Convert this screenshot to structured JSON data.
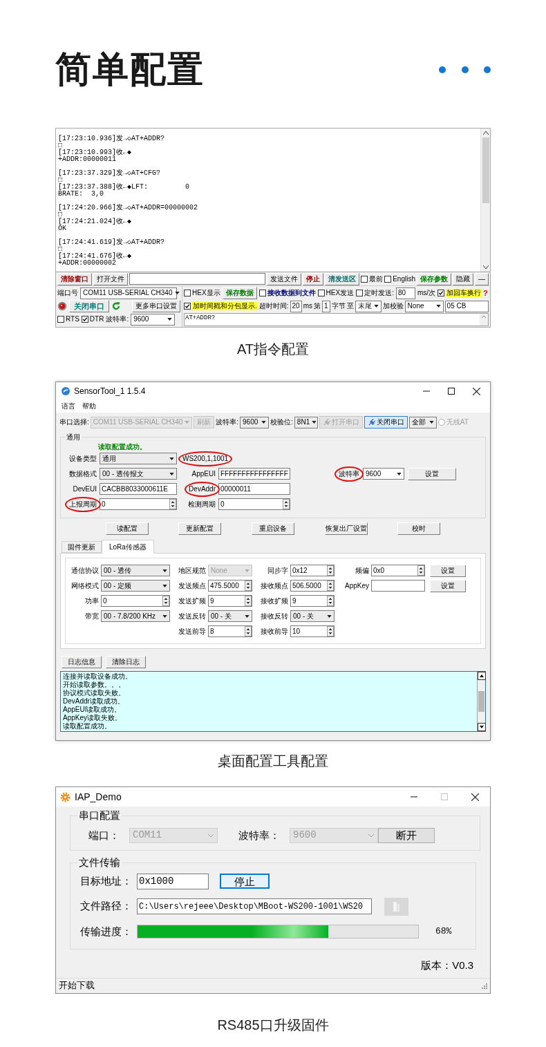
{
  "heading": {
    "title": "简单配置"
  },
  "at_tool": {
    "log": [
      {
        "lines": [
          "[17:23:10.936]发→◇AT+ADDR?",
          "□",
          "[17:23:10.993]收←◆",
          "+ADDR:00000011"
        ]
      },
      {
        "lines": [
          "[17:23:37.329]发→◇AT+CFG?",
          "□",
          "[17:23:37.388]收←◆LFT:         0",
          "BRATE:  3,0"
        ]
      },
      {
        "lines": [
          "[17:24:20.966]发→◇AT+ADDR=00000002",
          "□",
          "[17:24:21.024]收←◆",
          "OK"
        ]
      },
      {
        "lines": [
          "[17:24:41.619]发→◇AT+ADDR?",
          "□",
          "[17:24:41.676]收←◆",
          "+ADDR:00000002"
        ]
      }
    ],
    "toolbar": [
      {
        "kind": "button",
        "label": "清除窗口",
        "color": "#8b0000"
      },
      {
        "kind": "button",
        "label": "打开文件"
      },
      {
        "kind": "field"
      },
      {
        "kind": "button",
        "label": "发送文件"
      },
      {
        "kind": "button",
        "label": "停止",
        "color": "#a00000"
      },
      {
        "kind": "button",
        "label": "清发送区",
        "color": "#006b6b"
      },
      {
        "kind": "checkbox",
        "label": "最前",
        "checked": false
      },
      {
        "kind": "checkbox",
        "label": "English",
        "checked": false
      },
      {
        "kind": "button",
        "label": "保存参数",
        "color": "#008000"
      },
      {
        "kind": "button",
        "label": "隐藏"
      },
      {
        "kind": "button",
        "label": "—"
      }
    ],
    "port_panel": {
      "rows": [
        [
          {
            "kind": "label",
            "text": "端口号"
          },
          {
            "kind": "combo",
            "value": "COM11 USB-SERIAL CH340"
          }
        ],
        [
          {
            "kind": "button",
            "label": "关闭串口",
            "color": "#007a7a"
          },
          {
            "kind": "button",
            "label": "更多串口设置"
          }
        ],
        [
          {
            "kind": "checkbox",
            "label": "RTS",
            "checked": false
          },
          {
            "kind": "checkbox",
            "label": "DTR",
            "checked": true
          },
          {
            "kind": "label",
            "text": "波特率:"
          },
          {
            "kind": "combo",
            "value": "9600"
          }
        ]
      ]
    },
    "options_row_1": [
      {
        "kind": "checkbox",
        "label": "HEX显示",
        "checked": false
      },
      {
        "kind": "button",
        "label": "保存数据",
        "color": "#008000"
      },
      {
        "kind": "checkbox",
        "label": "接收数据到文件",
        "checked": false,
        "color": "#000080"
      },
      {
        "kind": "checkbox",
        "label": "HEX发送",
        "checked": false
      },
      {
        "kind": "checkbox",
        "label": "定时发送:",
        "checked": false
      },
      {
        "kind": "field",
        "value": "80"
      },
      {
        "kind": "label",
        "text": "ms/次"
      },
      {
        "kind": "checkbox",
        "label": "加回车换行",
        "checked": true,
        "highlighted": true
      }
    ],
    "help_mark": "?",
    "options_row_2": [
      {
        "kind": "checkbox",
        "label": "加时间戳和分包显示.",
        "checked": true,
        "highlighted": true
      },
      {
        "kind": "label",
        "text": "超时时间:"
      },
      {
        "kind": "field",
        "value": "20"
      },
      {
        "kind": "label",
        "text": "ms"
      },
      {
        "kind": "label",
        "text": "第"
      },
      {
        "kind": "field",
        "value": "1"
      },
      {
        "kind": "label",
        "text": "字节"
      },
      {
        "kind": "label",
        "text": "至"
      },
      {
        "kind": "combo",
        "value": "末尾"
      },
      {
        "kind": "label",
        "text": "加校验"
      },
      {
        "kind": "combo",
        "value": "None"
      },
      {
        "kind": "field",
        "value": "05 CB"
      }
    ],
    "send_text": "AT+ADDR?",
    "caption": "AT指令配置"
  },
  "sensor_tool": {
    "title": "SensorTool_1 1.5.4",
    "menu": [
      "语言",
      "帮助"
    ],
    "toolbar": [
      {
        "kind": "label",
        "text": "串口选择:"
      },
      {
        "kind": "combo",
        "value": "COM11 USB-SERIAL CH340",
        "disabled": true
      },
      {
        "kind": "button",
        "label": "刷新",
        "disabled": true
      },
      {
        "kind": "label",
        "text": "波特率:"
      },
      {
        "kind": "combo",
        "value": "9600"
      },
      {
        "kind": "label",
        "text": "校验位:"
      },
      {
        "kind": "combo",
        "value": "8N1"
      },
      {
        "kind": "button",
        "label": "打开串口",
        "disabled": true
      },
      {
        "kind": "button",
        "label": "关闭串口",
        "pressed": true
      },
      {
        "kind": "combo",
        "value": "全部"
      },
      {
        "kind": "radio",
        "label": "无线AT",
        "checked": false,
        "disabled": true
      }
    ],
    "general": {
      "legend": "通用",
      "status": "读取配置成功。",
      "rows": [
        [
          {
            "kind": "label",
            "text": "设备类型"
          },
          {
            "kind": "combo",
            "value": "通用"
          },
          {
            "kind": "value",
            "text": "WS200,1,1001",
            "circled": true
          }
        ],
        [
          {
            "kind": "label",
            "text": "数据格式"
          },
          {
            "kind": "combo",
            "value": "00 - 透传报文"
          },
          {
            "kind": "label",
            "text": "AppEUI"
          },
          {
            "kind": "field",
            "value": "FFFFFFFFFFFFFFFF"
          }
        ],
        [
          {
            "kind": "label",
            "text": "DevEUI"
          },
          {
            "kind": "field",
            "value": "CACBB8033000611E"
          },
          {
            "kind": "label",
            "text": "DevAddr",
            "circled": true
          },
          {
            "kind": "field",
            "value": "00000011"
          }
        ],
        [
          {
            "kind": "label",
            "text": "上报周期",
            "circled": true
          },
          {
            "kind": "spin",
            "value": "0"
          },
          {
            "kind": "label",
            "text": "检测周期"
          },
          {
            "kind": "spin",
            "value": "0"
          }
        ]
      ],
      "baud": [
        {
          "kind": "label",
          "text": "波特率",
          "circled": true
        },
        {
          "kind": "combo",
          "value": "9600"
        },
        {
          "kind": "button",
          "label": "设置"
        }
      ]
    },
    "actions": [
      "读配置",
      "更新配置",
      "重启设备",
      "恢复出厂设置",
      "校时"
    ],
    "tabs": [
      {
        "label": "固件更新",
        "selected": false
      },
      {
        "label": "LoRa传感器",
        "selected": true
      }
    ],
    "lora_columns": [
      [
        {
          "label": "通信协议",
          "control": {
            "kind": "combo",
            "value": "00 - 透传"
          }
        },
        {
          "label": "网络模式",
          "control": {
            "kind": "combo",
            "value": "00 - 定频"
          }
        },
        {
          "label": "功率",
          "control": {
            "kind": "spin",
            "value": "0"
          }
        },
        {
          "label": "带宽",
          "control": {
            "kind": "combo",
            "value": "00 - 7.8/200 KHz"
          }
        }
      ],
      [
        {
          "label": "地区规范",
          "control": {
            "kind": "combo",
            "value": "None",
            "disabled": true
          }
        },
        {
          "label": "发送频点",
          "control": {
            "kind": "spin",
            "value": "475.5000"
          }
        },
        {
          "label": "发送扩频",
          "control": {
            "kind": "spin",
            "value": "9"
          }
        },
        {
          "label": "发送反转",
          "control": {
            "kind": "combo",
            "value": "00 - 关"
          }
        },
        {
          "label": "发送前导",
          "control": {
            "kind": "spin",
            "value": "8"
          }
        }
      ],
      [
        {
          "label": "同步字",
          "control": {
            "kind": "spin",
            "value": "0x12"
          }
        },
        {
          "label": "接收频点",
          "control": {
            "kind": "spin",
            "value": "506.5000"
          }
        },
        {
          "label": "接收扩频",
          "control": {
            "kind": "spin",
            "value": "9"
          }
        },
        {
          "label": "接收反转",
          "control": {
            "kind": "combo",
            "value": "00 - 关"
          }
        },
        {
          "label": "接收前导",
          "control": {
            "kind": "spin",
            "value": "10"
          }
        }
      ],
      [
        {
          "label": "频偏",
          "control": {
            "kind": "spin",
            "value": "0x0"
          },
          "button": "设置"
        },
        {
          "label": "AppKey",
          "control": {
            "kind": "field"
          },
          "button": "设置"
        }
      ]
    ],
    "log_buttons": [
      "日志信息",
      "清除日志"
    ],
    "log_lines": [
      "连接并读取设备成功。",
      "开始读取参数。。。",
      "协议模式读取失败。",
      "DevAddr读取成功。",
      "AppEUI读取成功。",
      "AppKey读取失败。",
      "读取配置成功。"
    ],
    "caption": "桌面配置工具配置"
  },
  "iap_tool": {
    "title": "IAP_Demo",
    "maximize_disabled": true,
    "serial_group": {
      "legend": "串口配置",
      "port_label": "端口：",
      "port": {
        "value": "COM11",
        "disabled": true
      },
      "baud_label": "波特率：",
      "baud": {
        "value": "9600",
        "disabled": true
      },
      "button": "断开"
    },
    "transfer_group": {
      "legend": "文件传输",
      "address_label": "目标地址：",
      "address": "0x1000",
      "stop_button": "停止",
      "path_label": "文件路径：",
      "path": "C:\\Users\\rejeee\\Desktop\\MBoot-WS200-1001\\WS20",
      "browse_disabled": true,
      "progress_label": "传输进度：",
      "level": 0.68,
      "percent": "68%"
    },
    "version": "版本：V0.3",
    "status": "开始下载",
    "caption": "RS485口升级固件"
  }
}
